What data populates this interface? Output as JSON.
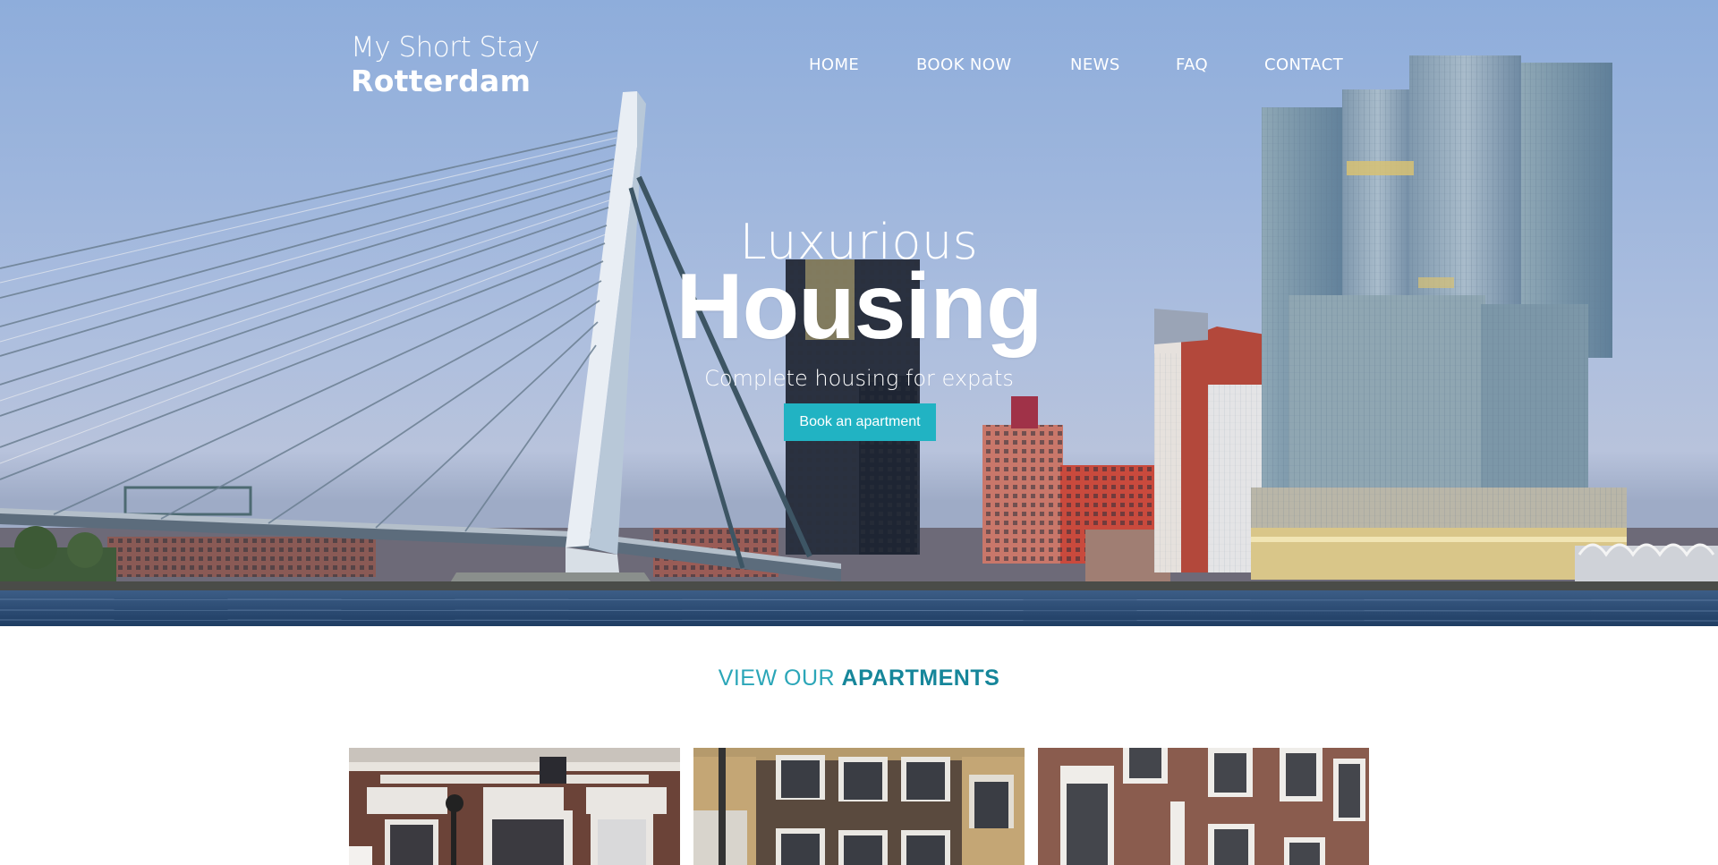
{
  "brand": {
    "line1": "My Short Stay",
    "line2": "Rotterdam"
  },
  "nav": {
    "items": [
      {
        "label": "HOME"
      },
      {
        "label": "BOOK NOW"
      },
      {
        "label": "NEWS"
      },
      {
        "label": "FAQ"
      },
      {
        "label": "CONTACT"
      }
    ]
  },
  "hero": {
    "title_light": "Luxurious",
    "title_bold": "Housing",
    "subtitle": "Complete housing for expats",
    "cta_label": "Book an apartment",
    "cta_color": "#21b3c3"
  },
  "apartments": {
    "heading_light": "VIEW OUR ",
    "heading_bold": "APARTMENTS",
    "accent_color": "#16869a",
    "cards": [
      {
        "name": "apartment-photo-1"
      },
      {
        "name": "apartment-photo-2"
      },
      {
        "name": "apartment-photo-3"
      }
    ]
  }
}
